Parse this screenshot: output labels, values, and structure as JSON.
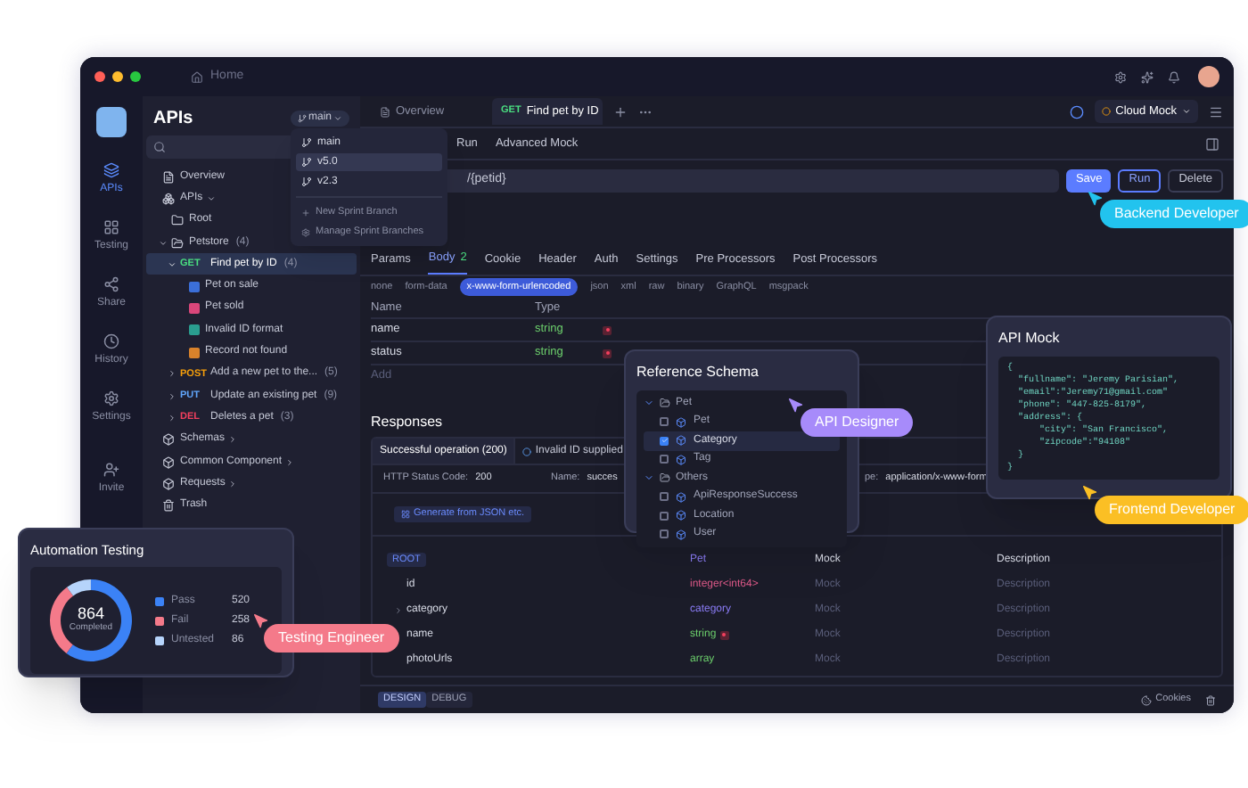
{
  "window": {
    "title": "Home"
  },
  "rail": [
    {
      "label": "APIs",
      "selected": true
    },
    {
      "label": "Testing",
      "selected": false
    },
    {
      "label": "Share",
      "selected": false
    },
    {
      "label": "History",
      "selected": false
    },
    {
      "label": "Settings",
      "selected": false
    },
    {
      "label": "Invite",
      "selected": false
    }
  ],
  "sidebar": {
    "title": "APIs",
    "branch": "main",
    "items": [
      {
        "label": "Overview",
        "kind": "overview"
      },
      {
        "label": "APIs",
        "kind": "group",
        "expanded": true,
        "children": [
          {
            "label": "Root",
            "kind": "folder"
          },
          {
            "label": "Petstore",
            "count": "(4)",
            "kind": "folder",
            "expanded": true,
            "children": [
              {
                "method": "GET",
                "label": "Find pet by ID",
                "count": "(4)",
                "kind": "endpoint",
                "expanded": true,
                "selected": true,
                "children": [
                  {
                    "label": "Pet on sale",
                    "kind": "case",
                    "color": "#3b6fd9"
                  },
                  {
                    "label": "Pet sold",
                    "kind": "case",
                    "color": "#d9467a"
                  },
                  {
                    "label": "Invalid ID format",
                    "kind": "case",
                    "color": "#2a9d8f"
                  },
                  {
                    "label": "Record not found",
                    "kind": "case",
                    "color": "#d9822b"
                  }
                ]
              },
              {
                "method": "POST",
                "label": "Add a new pet to the...",
                "count": "(5)",
                "kind": "endpoint",
                "expanded": false,
                "selected": false
              },
              {
                "method": "PUT",
                "label": "Update an existing pet",
                "count": "(9)",
                "kind": "endpoint",
                "expanded": false,
                "selected": false
              },
              {
                "method": "DEL",
                "label": "Deletes a pet",
                "count": "(3)",
                "kind": "endpoint",
                "expanded": false,
                "selected": false
              }
            ]
          }
        ]
      },
      {
        "label": "Schemas",
        "kind": "section"
      },
      {
        "label": "Common Component",
        "kind": "section"
      },
      {
        "label": "Requests",
        "kind": "section"
      },
      {
        "label": "Trash",
        "kind": "trash"
      }
    ]
  },
  "branch_menu": {
    "items": [
      {
        "label": "main",
        "selected": false
      },
      {
        "label": "v5.0",
        "selected": true
      },
      {
        "label": "v2.3",
        "selected": false
      }
    ],
    "actions": [
      "New Sprint Branch",
      "Manage Sprint Branches"
    ]
  },
  "tabs": [
    {
      "label": "Overview",
      "selected": false
    },
    {
      "method": "GET",
      "label": "Find pet by ID",
      "selected": true
    }
  ],
  "mock_server": "Cloud Mock",
  "sub_tabs": [
    {
      "label": "Run",
      "selected": false
    },
    {
      "label": "Advanced Mock",
      "selected": false
    }
  ],
  "url": "/{petid}",
  "actions": [
    {
      "label": "Save",
      "kind": "primary"
    },
    {
      "label": "Run",
      "kind": "outline"
    },
    {
      "label": "Delete",
      "kind": "plain"
    }
  ],
  "request_tabs": [
    {
      "label": "Params",
      "selected": false
    },
    {
      "label": "Body",
      "count": "2",
      "selected": true
    },
    {
      "label": "Cookie",
      "selected": false
    },
    {
      "label": "Header",
      "selected": false
    },
    {
      "label": "Auth",
      "selected": false
    },
    {
      "label": "Settings",
      "selected": false
    },
    {
      "label": "Pre Processors",
      "selected": false
    },
    {
      "label": "Post Processors",
      "selected": false
    }
  ],
  "body_types": [
    {
      "label": "none",
      "selected": false
    },
    {
      "label": "form-data",
      "selected": false
    },
    {
      "label": "x-www-form-urlencoded",
      "selected": true
    },
    {
      "label": "json",
      "selected": false
    },
    {
      "label": "xml",
      "selected": false
    },
    {
      "label": "raw",
      "selected": false
    },
    {
      "label": "binary",
      "selected": false
    },
    {
      "label": "GraphQL",
      "selected": false
    },
    {
      "label": "msgpack",
      "selected": false
    }
  ],
  "params_table": {
    "columns": [
      "Name",
      "Type"
    ],
    "rows": [
      {
        "name": "name",
        "type": "string",
        "required": true
      },
      {
        "name": "status",
        "type": "string",
        "required": true
      }
    ],
    "add": "Add"
  },
  "responses": {
    "title": "Responses",
    "tabs": [
      {
        "label": "Successful operation (200)",
        "selected": true
      },
      {
        "label": "Invalid ID supplied",
        "selected": false
      }
    ],
    "status_label": "HTTP Status Code:",
    "status": "200",
    "name_label": "Name:",
    "name": "succes",
    "type_label": "pe:",
    "type": "application/x-www-form",
    "generate": "Generate from JSON etc.",
    "schema": {
      "columns": [
        "ROOT",
        "Pet",
        "Mock",
        "Description"
      ],
      "rows": [
        {
          "name": "id",
          "type": "integer<int64>",
          "kind": "integer",
          "mock": "Mock",
          "description": "Description",
          "expandable": false,
          "required": false
        },
        {
          "name": "category",
          "type": "category",
          "kind": "ref",
          "mock": "Mock",
          "description": "Description",
          "expandable": true,
          "required": false
        },
        {
          "name": "name",
          "type": "string",
          "kind": "string",
          "mock": "Mock",
          "description": "Description",
          "expandable": false,
          "required": true
        },
        {
          "name": "photoUrls",
          "type": "array",
          "kind": "array",
          "mock": "Mock",
          "description": "Description",
          "expandable": false,
          "required": false
        }
      ]
    }
  },
  "bottom_bar": {
    "modes": [
      {
        "label": "DESIGN",
        "selected": true
      },
      {
        "label": "DEBUG",
        "selected": false
      }
    ],
    "cookies": "Cookies"
  },
  "reference_schema": {
    "title": "Reference Schema",
    "groups": [
      {
        "label": "Pet",
        "expanded": true,
        "items": [
          {
            "label": "Pet",
            "checked": false,
            "selected": false
          },
          {
            "label": "Category",
            "checked": true,
            "selected": true
          },
          {
            "label": "Tag",
            "checked": false,
            "selected": false
          }
        ]
      },
      {
        "label": "Others",
        "expanded": true,
        "items": [
          {
            "label": "ApiResponseSuccess",
            "checked": false,
            "selected": false
          },
          {
            "label": "Location",
            "checked": false,
            "selected": false
          },
          {
            "label": "User",
            "checked": false,
            "selected": false
          }
        ]
      }
    ]
  },
  "api_mock": {
    "title": "API Mock",
    "code": [
      "{",
      "  \"fullname\": \"Jeremy Parisian\",",
      "  \"email\":\"Jeremy71@gmail.com\"",
      "  \"phone\": \"447-825-8179\",",
      "  \"address\": {",
      "      \"city\": \"San Francisco\",",
      "      \"zipcode\":\"94108\"",
      "  }",
      "}"
    ]
  },
  "automation": {
    "title": "Automation Testing",
    "total": "864",
    "total_label": "Completed",
    "legend": [
      {
        "value": "520",
        "color": "#3b82f6"
      },
      {
        "value": "258",
        "color": "#f47a8a"
      },
      {
        "value": "86",
        "color": "#b6d4fb"
      }
    ],
    "chart_data": {
      "type": "donut",
      "categories": [
        "Pass",
        "Fail",
        "Untested"
      ],
      "series": [
        {
          "values": [
            60.19,
            29.86,
            9.95
          ]
        }
      ]
    }
  },
  "callouts": [
    {
      "label": "Backend Developer",
      "color": "#22c3ee"
    },
    {
      "label": "API Designer",
      "color": "#a78bfa"
    },
    {
      "label": "Frontend Developer",
      "color": "#fbbf24"
    },
    {
      "label": "Testing Engineer",
      "color": "#f47a8a"
    }
  ]
}
